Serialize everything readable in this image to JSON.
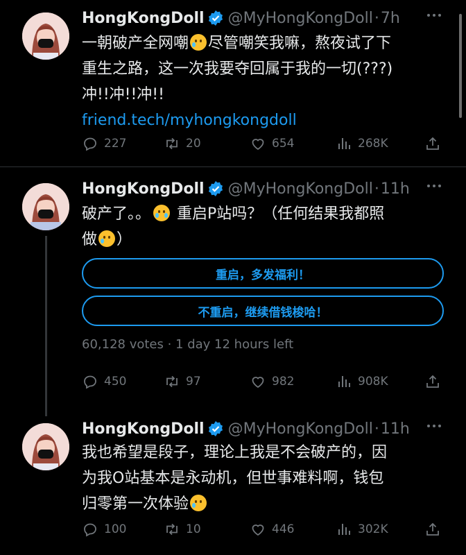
{
  "tweets": [
    {
      "name": "HongKongDoll",
      "handle": "@MyHongKongDoll",
      "dot": "·",
      "time": "7h",
      "text_line1a": "一朝破产全网嘲",
      "text_line1b": "尽管嘲笑我嘛，熬夜试了下",
      "text_line2": "重生之路，这一次我要夺回属于我的一切(???)",
      "text_line3": "冲!!冲!!冲!!",
      "link": "friend.tech/myhongkongdoll",
      "replies": "227",
      "retweets": "20",
      "likes": "654",
      "views": "268K"
    },
    {
      "name": "HongKongDoll",
      "handle": "@MyHongKongDoll",
      "dot": "·",
      "time": "11h",
      "text_line1": "破产了。。",
      "text_line1b": "重启P站吗？（任何结果我都照",
      "text_line2": "做",
      "text_line2b": "）",
      "poll_option_1": "重启，多发福利！",
      "poll_option_2": "不重启，继续借钱梭哈！",
      "poll_meta": "60,128 votes · 1 day 12 hours left",
      "replies": "450",
      "retweets": "97",
      "likes": "982",
      "views": "908K"
    },
    {
      "name": "HongKongDoll",
      "handle": "@MyHongKongDoll",
      "dot": "·",
      "time": "11h",
      "text_line1": "我也希望是段子，理论上我是不会破产的，因",
      "text_line2": "为我O站基本是永动机，但世事难料啊，钱包",
      "text_line3": "归零第一次体验",
      "replies": "100",
      "retweets": "10",
      "likes": "446",
      "views": "302K"
    }
  ],
  "icons": {
    "reply": "reply-icon",
    "retweet": "retweet-icon",
    "like": "heart-icon",
    "views": "views-icon",
    "share": "share-icon",
    "verified": "verified-badge-icon",
    "more": "more-icon"
  },
  "colors": {
    "background": "#000000",
    "text": "#e7e9ea",
    "muted": "#71767b",
    "accent": "#1d9bf0"
  }
}
